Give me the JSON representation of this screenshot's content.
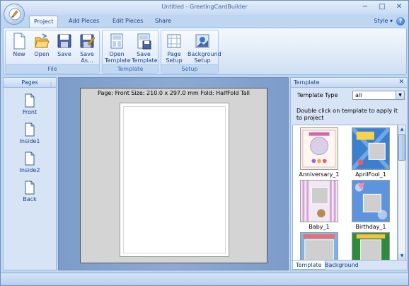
{
  "window": {
    "title": "Untitled - GreetingCardBuilder"
  },
  "title_buttons": {
    "minimize": "−",
    "maximize": "□",
    "close": "✕"
  },
  "tabs": [
    {
      "label": "Project",
      "active": true
    },
    {
      "label": "Add Pieces",
      "active": false
    },
    {
      "label": "Edit Pieces",
      "active": false
    },
    {
      "label": "Share",
      "active": false
    }
  ],
  "style_menu": {
    "label": "Style",
    "arrow": "▾"
  },
  "help": {
    "glyph": "?"
  },
  "ribbon": {
    "groups": [
      {
        "label": "File",
        "buttons": [
          {
            "label": "New"
          },
          {
            "label": "Open"
          },
          {
            "label": "Save"
          },
          {
            "label": "Save As..."
          }
        ]
      },
      {
        "label": "Template",
        "buttons": [
          {
            "label": "Open Template"
          },
          {
            "label": "Save Template"
          }
        ]
      },
      {
        "label": "Setup",
        "buttons": [
          {
            "label": "Page Setup"
          },
          {
            "label": "Background Setup"
          }
        ]
      }
    ]
  },
  "pages_panel": {
    "title": "Pages",
    "grip": "⋮",
    "items": [
      {
        "label": "Front"
      },
      {
        "label": "Inside1"
      },
      {
        "label": "Inside2"
      },
      {
        "label": "Back"
      }
    ]
  },
  "canvas": {
    "info": "Page: Front   Size: 210.0 x 297.0 mm   Fold: HalfFold Tall"
  },
  "template_panel": {
    "title": "Template",
    "close": "✕",
    "type_label": "Template Type",
    "type_value": "all",
    "hint": "Double click on template to apply it to project",
    "templates": [
      {
        "label": "Anniversary_1"
      },
      {
        "label": "AprilFool_1"
      },
      {
        "label": "Baby_1"
      },
      {
        "label": "Birthday_1"
      }
    ],
    "tabs": [
      {
        "label": "Template",
        "active": true
      },
      {
        "label": "Background",
        "active": false
      }
    ]
  },
  "colors": {
    "accent": "#15428b",
    "ribbon_bg": "#dbe7f6",
    "canvas_bg": "#8eaad3"
  }
}
